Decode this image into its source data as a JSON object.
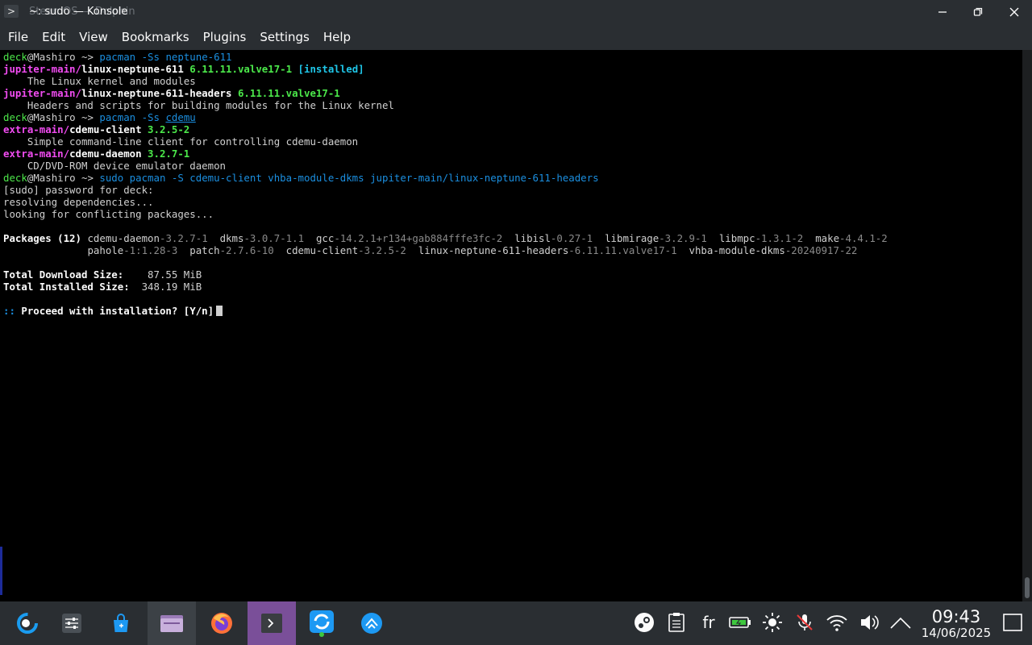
{
  "window": {
    "title_ghost": "SteamOS — Dolphin",
    "title": "~ : sudo — Konsole",
    "title_display": "~: sudo — Konsole"
  },
  "menu": [
    "File",
    "Edit",
    "View",
    "Bookmarks",
    "Plugins",
    "Settings",
    "Help"
  ],
  "terminal": {
    "lines": [
      "deck@Mashiro ~> pacman -Ss neptune-611",
      "jupiter-main/linux-neptune-611 6.11.11.valve17-1 [installed]",
      "    The Linux kernel and modules",
      "jupiter-main/linux-neptune-611-headers 6.11.11.valve17-1",
      "    Headers and scripts for building modules for the Linux kernel",
      "deck@Mashiro ~> pacman -Ss cdemu",
      "extra-main/cdemu-client 3.2.5-2",
      "    Simple command-line client for controlling cdemu-daemon",
      "extra-main/cdemu-daemon 3.2.7-1",
      "    CD/DVD-ROM device emulator daemon",
      "deck@Mashiro ~> sudo pacman -S cdemu-client vhba-module-dkms jupiter-main/linux-neptune-611-headers",
      "[sudo] password for deck:",
      "resolving dependencies...",
      "looking for conflicting packages...",
      "",
      "Packages (12) cdemu-daemon-3.2.7-1  dkms-3.0.7-1.1  gcc-14.2.1+r134+gab884fffe3fc-2  libisl-0.27-1  libmirage-3.2.9-1  libmpc-1.3.1-2  make-4.4.1-2",
      "              pahole-1:1.28-3  patch-2.7.6-10  cdemu-client-3.2.5-2  linux-neptune-611-headers-6.11.11.valve17-1  vhba-module-dkms-20240917-22",
      "",
      "Total Download Size:    87.55 MiB",
      "Total Installed Size:  348.19 MiB",
      "",
      ":: Proceed with installation? [Y/n] "
    ],
    "parts": {
      "user": "deck",
      "at": "@",
      "host": "Mashiro",
      "prompt": " ~> ",
      "cmd1_bin": "pacman",
      "cmd1_args": " -Ss neptune-611",
      "pkg1_repo": "jupiter-main/",
      "pkg1_name": "linux-neptune-611",
      "pkg1_ver": " 6.11.11.valve17-1",
      "pkg1_tag": " [installed]",
      "pkg1_desc": "    The Linux kernel and modules",
      "pkg2_name": "linux-neptune-611-headers",
      "pkg2_ver": " 6.11.11.valve17-1",
      "pkg2_desc": "    Headers and scripts for building modules for the Linux kernel",
      "cmd2_args": " -Ss ",
      "cmd2_term": "cdemu",
      "repo_extra": "extra-main/",
      "pkg3_name": "cdemu-client",
      "pkg3_ver": " 3.2.5-2",
      "pkg3_desc": "    Simple command-line client for controlling cdemu-daemon",
      "pkg4_name": "cdemu-daemon",
      "pkg4_ver": " 3.2.7-1",
      "pkg4_desc": "    CD/DVD-ROM device emulator daemon",
      "cmd3": "sudo pacman -S cdemu-client vhba-module-dkms jupiter-main/linux-neptune-611-headers",
      "sudo_prompt": "[sudo] password for deck:",
      "resolving": "resolving dependencies...",
      "conflicts": "looking for conflicting packages...",
      "packages_label": "Packages (12)",
      "pk_cdemu_daemon": "cdemu-daemon",
      "pk_cdemu_daemon_v": "-3.2.7-1",
      "pk_dkms": "dkms",
      "pk_dkms_v": "-3.0.7-1.1",
      "pk_gcc": "gcc",
      "pk_gcc_v": "-14.2.1+r134+gab884fffe3fc-2",
      "pk_libisl": "libisl",
      "pk_libisl_v": "-0.27-1",
      "pk_libmirage": "libmirage",
      "pk_libmirage_v": "-3.2.9-1",
      "pk_libmpc": "libmpc",
      "pk_libmpc_v": "-1.3.1-2",
      "pk_make": "make",
      "pk_make_v": "-4.4.1-2",
      "pk_pahole": "pahole",
      "pk_pahole_v": "-1:1.28-3",
      "pk_patch": "patch",
      "pk_patch_v": "-2.7.6-10",
      "pk_cdemu_client": "cdemu-client",
      "pk_cdemu_client_v": "-3.2.5-2",
      "pk_headers": "linux-neptune-611-headers",
      "pk_headers_v": "-6.11.11.valve17-1",
      "pk_vhba": "vhba-module-dkms",
      "pk_vhba_v": "-20240917-22",
      "dl_label": "Total Download Size:",
      "dl_value": "    87.55 MiB",
      "inst_label": "Total Installed Size:",
      "inst_value": "  348.19 MiB",
      "proceed_marker": "::",
      "proceed_text": " Proceed with installation? [Y/n]"
    }
  },
  "taskbar": {
    "apps": [
      "application-launcher-icon",
      "system-settings-icon",
      "discover-store-icon",
      "dolphin-files-icon",
      "firefox-icon",
      "konsole-icon",
      "update-icon",
      "kdeconnect-icon"
    ],
    "tray": [
      "steam-icon",
      "clipboard-icon",
      "keyboard-layout",
      "battery-icon",
      "brightness-icon",
      "microphone-muted-icon",
      "wifi-icon",
      "volume-icon",
      "expand-tray-icon"
    ],
    "keyboard_layout": "fr",
    "time": "09:43",
    "date": "14/06/2025"
  },
  "colors": {
    "titlebar": "#2a2e32",
    "terminal_bg": "#000000",
    "prompt_user": "#4de84a",
    "command": "#1b8fe0",
    "repo": "#f24cf2",
    "version": "#4be84a",
    "installed_tag": "#1fc6e8",
    "konsole_active": "#7a4f99"
  }
}
